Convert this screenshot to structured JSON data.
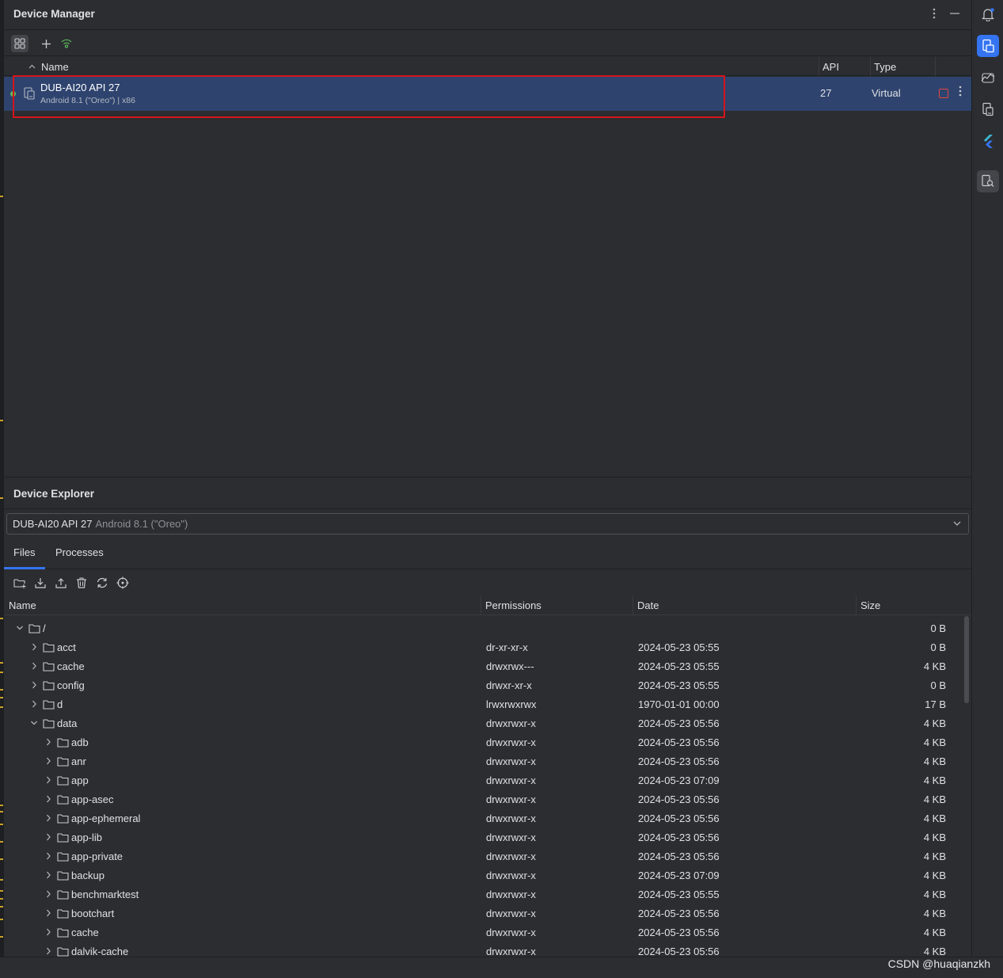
{
  "device_manager": {
    "title": "Device Manager",
    "columns": {
      "name": "Name",
      "api": "API",
      "type": "Type"
    },
    "device": {
      "name": "DUB-AI20 API 27",
      "subtitle": "Android 8.1 (\"Oreo\") | x86",
      "api": "27",
      "type": "Virtual",
      "status": "online"
    }
  },
  "device_explorer": {
    "title": "Device Explorer",
    "selector": {
      "name": "DUB-AI20 API 27",
      "subtitle": "Android 8.1 (\"Oreo\")"
    },
    "tabs": [
      "Files",
      "Processes"
    ],
    "active_tab": "Files",
    "columns": {
      "name": "Name",
      "permissions": "Permissions",
      "date": "Date",
      "size": "Size"
    },
    "files": [
      {
        "name": "/",
        "depth": 0,
        "expanded": true,
        "permissions": "",
        "date": "",
        "size": "0 B"
      },
      {
        "name": "acct",
        "depth": 1,
        "expanded": false,
        "permissions": "dr-xr-xr-x",
        "date": "2024-05-23 05:55",
        "size": "0 B"
      },
      {
        "name": "cache",
        "depth": 1,
        "expanded": false,
        "permissions": "drwxrwx---",
        "date": "2024-05-23 05:55",
        "size": "4 KB"
      },
      {
        "name": "config",
        "depth": 1,
        "expanded": false,
        "permissions": "drwxr-xr-x",
        "date": "2024-05-23 05:55",
        "size": "0 B"
      },
      {
        "name": "d",
        "depth": 1,
        "expanded": false,
        "permissions": "lrwxrwxrwx",
        "date": "1970-01-01 00:00",
        "size": "17 B"
      },
      {
        "name": "data",
        "depth": 1,
        "expanded": true,
        "permissions": "drwxrwxr-x",
        "date": "2024-05-23 05:56",
        "size": "4 KB"
      },
      {
        "name": "adb",
        "depth": 2,
        "expanded": false,
        "permissions": "drwxrwxr-x",
        "date": "2024-05-23 05:56",
        "size": "4 KB"
      },
      {
        "name": "anr",
        "depth": 2,
        "expanded": false,
        "permissions": "drwxrwxr-x",
        "date": "2024-05-23 05:56",
        "size": "4 KB"
      },
      {
        "name": "app",
        "depth": 2,
        "expanded": false,
        "permissions": "drwxrwxr-x",
        "date": "2024-05-23 07:09",
        "size": "4 KB"
      },
      {
        "name": "app-asec",
        "depth": 2,
        "expanded": false,
        "permissions": "drwxrwxr-x",
        "date": "2024-05-23 05:56",
        "size": "4 KB"
      },
      {
        "name": "app-ephemeral",
        "depth": 2,
        "expanded": false,
        "permissions": "drwxrwxr-x",
        "date": "2024-05-23 05:56",
        "size": "4 KB"
      },
      {
        "name": "app-lib",
        "depth": 2,
        "expanded": false,
        "permissions": "drwxrwxr-x",
        "date": "2024-05-23 05:56",
        "size": "4 KB"
      },
      {
        "name": "app-private",
        "depth": 2,
        "expanded": false,
        "permissions": "drwxrwxr-x",
        "date": "2024-05-23 05:56",
        "size": "4 KB"
      },
      {
        "name": "backup",
        "depth": 2,
        "expanded": false,
        "permissions": "drwxrwxr-x",
        "date": "2024-05-23 07:09",
        "size": "4 KB"
      },
      {
        "name": "benchmarktest",
        "depth": 2,
        "expanded": false,
        "permissions": "drwxrwxr-x",
        "date": "2024-05-23 05:55",
        "size": "4 KB"
      },
      {
        "name": "bootchart",
        "depth": 2,
        "expanded": false,
        "permissions": "drwxrwxr-x",
        "date": "2024-05-23 05:56",
        "size": "4 KB"
      },
      {
        "name": "cache",
        "depth": 2,
        "expanded": false,
        "permissions": "drwxrwxr-x",
        "date": "2024-05-23 05:56",
        "size": "4 KB"
      },
      {
        "name": "dalvik-cache",
        "depth": 2,
        "expanded": false,
        "permissions": "drwxrwxr-x",
        "date": "2024-05-23 05:56",
        "size": "4 KB"
      }
    ]
  },
  "watermark": "CSDN @huaqianzkh",
  "colors": {
    "accent": "#3574f0",
    "selection": "#2e436e",
    "highlight_box": "#d4151b",
    "online": "#5fb85f",
    "stop": "#e0473f"
  },
  "icons": {
    "right_bar": [
      "notifications-icon",
      "device-manager-icon",
      "app-inspection-icon",
      "running-devices-icon",
      "flutter-icon",
      "device-explorer-icon"
    ]
  }
}
